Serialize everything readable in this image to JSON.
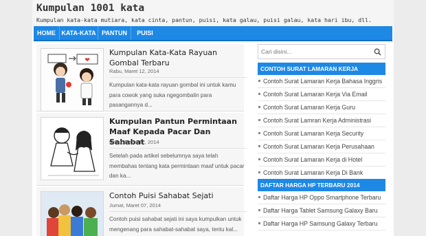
{
  "site": {
    "title": "Kumpulan 1001 kata",
    "description": "Kumpulan kata-kata mutiara, kata cinta, pantun, puisi, kata galau, puisi galau, kata hari ibu, dll."
  },
  "nav": {
    "items": [
      {
        "label": "HOME"
      },
      {
        "label": "KATA-KATA"
      },
      {
        "label": "PANTUN"
      },
      {
        "label": "PUISI"
      }
    ]
  },
  "posts": [
    {
      "title": "Kumpulan Kata-Kata Rayuan Gombal Terbaru",
      "date": "Rabu, Maret 12, 2014",
      "excerpt": "Kumpulan kata-kata rayuan gombal ini untuk kamu para cowok yang suka ngegombalin para pasangannya d..."
    },
    {
      "title": "Kumpulan Pantun Permintaan Maaf Kepada Pacar Dan Sahabat",
      "date": "Rabu, Maret 12, 2014",
      "excerpt": "Setelah pada artikel sebelumnya saya telah membahas tentang kata permintaan maaf untuk pacar dan ka..."
    },
    {
      "title": "Contoh Puisi Sahabat Sejati",
      "date": "Jumat, Maret 07, 2014",
      "excerpt": "Contoh puisi sahabat sejati ini saya kumpulkan untuk mengenang para sahabat-sahabat saya, tentu kal..."
    }
  ],
  "sidebar": {
    "search_placeholder": "Cari disini...",
    "widgets": [
      {
        "title": "CONTOH SURAT LAMARAN KERJA",
        "links": [
          "Contoh Surat Lamaran Kerja Bahasa Inggris",
          "Contoh Surat Lamaran Kerja Via Email",
          "Contoh Surat Lamaran Kerja Guru",
          "Contoh Surat Lamran Kerja Administrasi",
          "Contoh Surat Lamaran Kerja Security",
          "Contoh Surat Lamaran Kerja Perusahaan",
          "Contoh Surat Lamaran Kerja di Hotel",
          "Contoh Surat Lamaran Kerja Di Bank"
        ]
      },
      {
        "title": "DAFTAR HARGA HP TERBARU 2014",
        "links": [
          "Daftar Harga HP Oppo Smartphone Terbaru",
          "Daftar Harga Tablet Samsung Galaxy Baru",
          "Daftar Harga HP Samsung Galaxy Terbaru"
        ]
      }
    ]
  },
  "colors": {
    "accent": "#1e88e5",
    "background": "#ececec"
  }
}
